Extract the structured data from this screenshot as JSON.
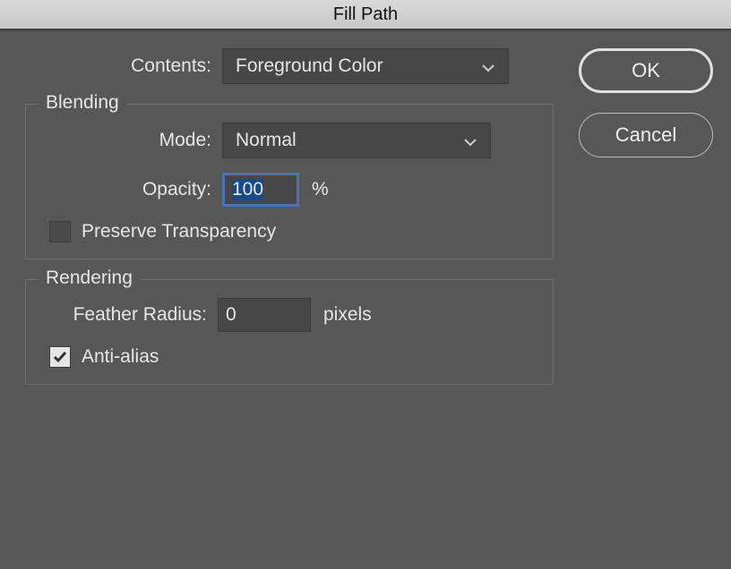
{
  "dialog": {
    "title": "Fill Path"
  },
  "contents": {
    "label": "Contents:",
    "value": "Foreground Color"
  },
  "blending": {
    "group_title": "Blending",
    "mode_label": "Mode:",
    "mode_value": "Normal",
    "opacity_label": "Opacity:",
    "opacity_value": "100",
    "opacity_unit": "%",
    "preserve_transparency_label": "Preserve Transparency",
    "preserve_transparency_checked": false
  },
  "rendering": {
    "group_title": "Rendering",
    "feather_label": "Feather Radius:",
    "feather_value": "0",
    "feather_unit": "pixels",
    "antialias_label": "Anti-alias",
    "antialias_checked": true
  },
  "buttons": {
    "ok": "OK",
    "cancel": "Cancel"
  }
}
